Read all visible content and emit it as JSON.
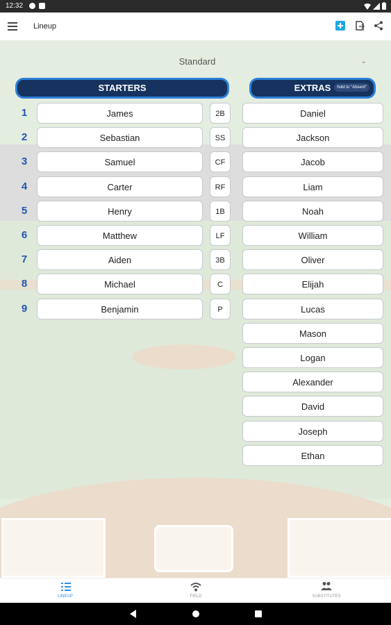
{
  "status_bar": {
    "time": "12:32"
  },
  "app_bar": {
    "title": "Lineup"
  },
  "lineup_type": {
    "selected": "Standard"
  },
  "starters_header": "STARTERS",
  "extras_header": "EXTRAS",
  "extras_hint": "hold to \"Absent\"",
  "starters": [
    {
      "order": "1",
      "name": "James",
      "position": "2B"
    },
    {
      "order": "2",
      "name": "Sebastian",
      "position": "SS"
    },
    {
      "order": "3",
      "name": "Samuel",
      "position": "CF"
    },
    {
      "order": "4",
      "name": "Carter",
      "position": "RF"
    },
    {
      "order": "5",
      "name": "Henry",
      "position": "1B"
    },
    {
      "order": "6",
      "name": "Matthew",
      "position": "LF"
    },
    {
      "order": "7",
      "name": "Aiden",
      "position": "3B"
    },
    {
      "order": "8",
      "name": "Michael",
      "position": "C"
    },
    {
      "order": "9",
      "name": "Benjamin",
      "position": "P"
    }
  ],
  "extras": [
    "Daniel",
    "Jackson",
    "Jacob",
    "Liam",
    "Noah",
    "William",
    "Oliver",
    "Elijah",
    "Lucas",
    "Mason",
    "Logan",
    "Alexander",
    "David",
    "Joseph",
    "Ethan"
  ],
  "bottom_nav": [
    {
      "label": "LINEUP",
      "icon": "list-icon",
      "active": true
    },
    {
      "label": "FIELD",
      "icon": "field-icon",
      "active": false
    },
    {
      "label": "SUBSTITUTES",
      "icon": "people-icon",
      "active": false
    }
  ],
  "colors": {
    "header_fill": "#16325e",
    "header_border": "#2e80d8",
    "order_number": "#1f55b0",
    "active_tab": "#2d8ee8"
  }
}
